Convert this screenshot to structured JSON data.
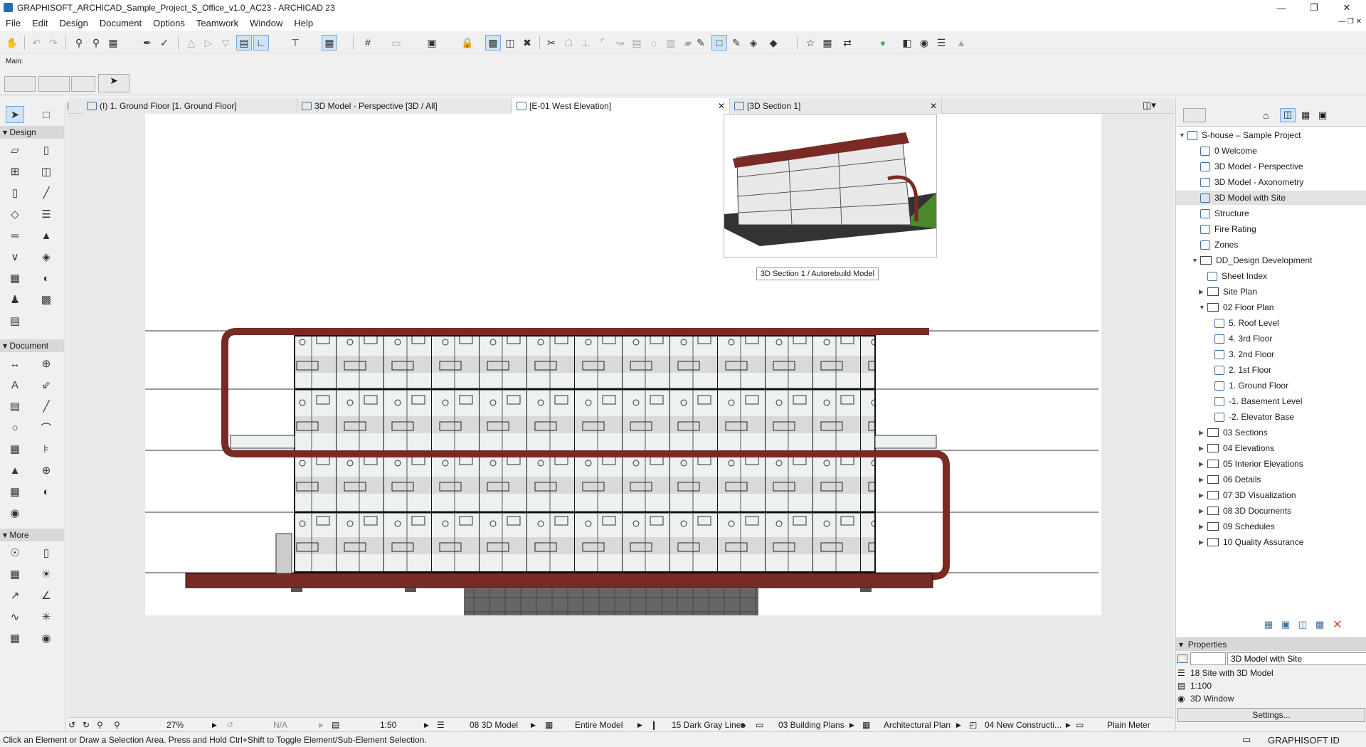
{
  "window": {
    "title": "GRAPHISOFT_ARCHICAD_Sample_Project_S_Office_v1.0_AC23 - ARCHICAD 23"
  },
  "menu": [
    "File",
    "Edit",
    "Design",
    "Document",
    "Options",
    "Teamwork",
    "Window",
    "Help"
  ],
  "infobox": {
    "label": "Main:"
  },
  "tabs": [
    {
      "label": "(I) 1. Ground Floor [1. Ground Floor]"
    },
    {
      "label": "3D Model - Perspective [3D / All]"
    },
    {
      "label": "[E-01 West Elevation]"
    },
    {
      "label": "[3D Section 1]"
    }
  ],
  "toolbox": {
    "sections": [
      "Design",
      "Document",
      "More"
    ]
  },
  "preview": {
    "caption": "3D Section 1 / Autorebuild Model"
  },
  "navigator": {
    "items": [
      {
        "label": "S-house – Sample Project",
        "level": 0,
        "type": "root"
      },
      {
        "label": "0 Welcome",
        "level": 1,
        "type": "view"
      },
      {
        "label": "3D Model - Perspective",
        "level": 1,
        "type": "view"
      },
      {
        "label": "3D Model - Axonometry",
        "level": 1,
        "type": "view"
      },
      {
        "label": "3D Model with Site",
        "level": 1,
        "type": "view",
        "selected": true
      },
      {
        "label": "Structure",
        "level": 1,
        "type": "view"
      },
      {
        "label": "Fire Rating",
        "level": 1,
        "type": "view"
      },
      {
        "label": "Zones",
        "level": 1,
        "type": "view"
      },
      {
        "label": "DD_Design Development",
        "level": 1,
        "type": "folder",
        "expanded": true
      },
      {
        "label": "Sheet Index",
        "level": 2,
        "type": "view"
      },
      {
        "label": "Site Plan",
        "level": 2,
        "type": "folder"
      },
      {
        "label": "02 Floor Plan",
        "level": 2,
        "type": "folder",
        "expanded": true
      },
      {
        "label": "5. Roof Level",
        "level": 3,
        "type": "view"
      },
      {
        "label": "4. 3rd Floor",
        "level": 3,
        "type": "view"
      },
      {
        "label": "3. 2nd Floor",
        "level": 3,
        "type": "view"
      },
      {
        "label": "2. 1st Floor",
        "level": 3,
        "type": "view"
      },
      {
        "label": "1. Ground Floor",
        "level": 3,
        "type": "view"
      },
      {
        "label": "-1. Basement Level",
        "level": 3,
        "type": "view"
      },
      {
        "label": "-2. Elevator Base",
        "level": 3,
        "type": "view"
      },
      {
        "label": "03 Sections",
        "level": 2,
        "type": "folder"
      },
      {
        "label": "04 Elevations",
        "level": 2,
        "type": "folder"
      },
      {
        "label": "05 Interior Elevations",
        "level": 2,
        "type": "folder"
      },
      {
        "label": "06 Details",
        "level": 2,
        "type": "folder"
      },
      {
        "label": "07 3D Visualization",
        "level": 2,
        "type": "folder"
      },
      {
        "label": "08 3D Documents",
        "level": 2,
        "type": "folder"
      },
      {
        "label": "09 Schedules",
        "level": 2,
        "type": "folder"
      },
      {
        "label": "10 Quality Assurance",
        "level": 2,
        "type": "folder"
      }
    ]
  },
  "properties": {
    "header": "Properties",
    "name": "3D Model with Site",
    "layer_combination": "18 Site with 3D Model",
    "scale": "1:100",
    "view_type": "3D Window",
    "settings_button": "Settings..."
  },
  "status_controls": {
    "zoom": "27%",
    "angle": "N/A",
    "scale": "1:50",
    "layer_combo": "08 3D Model",
    "model_view": "Entire Model",
    "pen_set": "15 Dark Gray Lines",
    "model_view_option": "03 Building Plans",
    "dimension": "Architectural Plan",
    "renovation": "04 New Constructi...",
    "units": "Plain Meter"
  },
  "statusbar": {
    "message": "Click an Element or Draw a Selection Area. Press and Hold Ctrl+Shift to Toggle Element/Sub-Element Selection.",
    "graphisoft_id": "GRAPHISOFT ID"
  },
  "colors": {
    "frame": "#7a2a24",
    "accent": "#3a6ea5",
    "selection": "#cfe2f7"
  }
}
